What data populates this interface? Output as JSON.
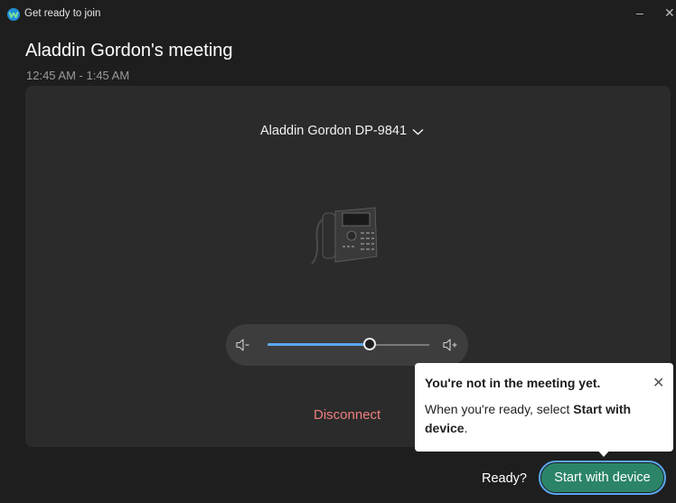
{
  "window": {
    "title": "Get ready to join",
    "minimize_glyph": "–",
    "close_glyph": "✕"
  },
  "meeting": {
    "title": "Aladdin Gordon's meeting",
    "time": "12:45 AM - 1:45 AM"
  },
  "device": {
    "name": "Aladdin Gordon DP-9841",
    "icon": "desk-phone-icon"
  },
  "volume": {
    "level_percent": 64,
    "down_icon": "volume-down-icon",
    "up_icon": "volume-up-icon"
  },
  "actions": {
    "disconnect_label": "Disconnect",
    "ready_label": "Ready?",
    "start_label": "Start with device"
  },
  "tooltip": {
    "title": "You're not in the meeting yet.",
    "body_prefix": "When you're ready, select ",
    "body_bold": "Start with device",
    "body_suffix": "."
  },
  "colors": {
    "accent_green": "#2b8468",
    "focus_blue": "#5aa7f0",
    "disconnect_red": "#f07f7f",
    "background": "#1e1e1e",
    "panel": "#2b2b2b"
  }
}
